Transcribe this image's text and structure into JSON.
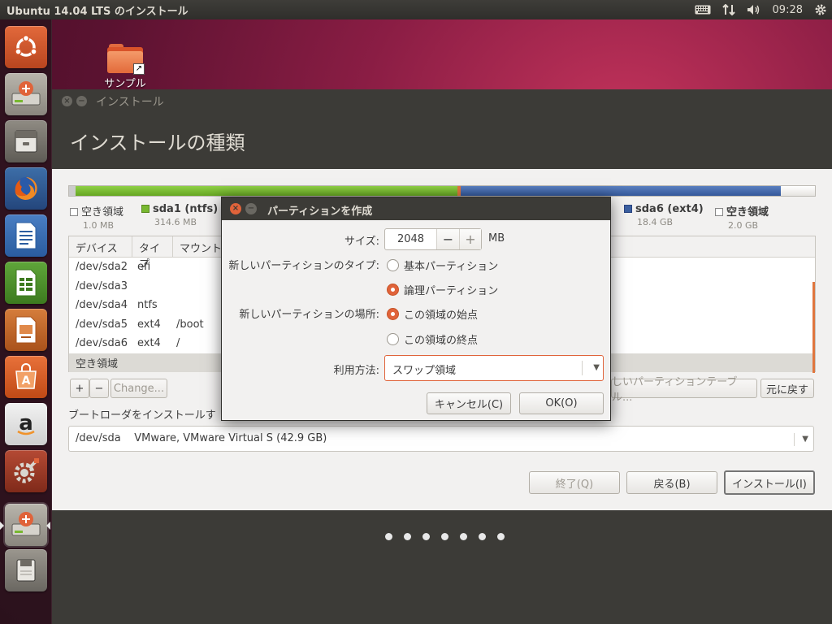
{
  "top_panel": {
    "title": "Ubuntu 14.04 LTS のインストール",
    "clock": "09:28",
    "icons": [
      "keyboard-icon",
      "network-icon",
      "volume-icon",
      "gear-icon"
    ]
  },
  "launcher": {
    "items": [
      "dash-home",
      "installer",
      "file-manager",
      "firefox",
      "libreoffice-writer",
      "libreoffice-calc",
      "libreoffice-impress",
      "software-center",
      "amazon",
      "system-settings",
      "installer-running",
      "trash"
    ]
  },
  "desktop": {
    "icon_label": "サンプル"
  },
  "installer": {
    "window_title": "インストール",
    "heading": "インストールの種類",
    "partition_bar": {
      "segments": [
        {
          "name": "空き領域",
          "color": "#ffffff",
          "size": "1.0 MB"
        },
        {
          "name": "sda1 (ntfs)",
          "color": "#78b830",
          "size": "314.6 MB"
        },
        {
          "name": "sda6 (ext4)",
          "color": "#3b5fa0",
          "size": "18.4 GB"
        },
        {
          "name": "空き領域",
          "color": "#ffffff",
          "size": "2.0 GB"
        }
      ]
    },
    "table": {
      "headers": [
        "デバイス",
        "タイプ",
        "マウント"
      ],
      "rows": [
        {
          "device": "/dev/sda2",
          "type": "efi",
          "mount": ""
        },
        {
          "device": "/dev/sda3",
          "type": "",
          "mount": ""
        },
        {
          "device": "/dev/sda4",
          "type": "ntfs",
          "mount": ""
        },
        {
          "device": "/dev/sda5",
          "type": "ext4",
          "mount": "/boot"
        },
        {
          "device": "/dev/sda6",
          "type": "ext4",
          "mount": "/"
        },
        {
          "device": "空き領域",
          "type": "",
          "mount": ""
        }
      ]
    },
    "toolbar": {
      "add": "+",
      "remove": "−",
      "change": "Change...",
      "new_table": "しいパーティションテーブル...",
      "revert": "元に戻す"
    },
    "bootloader_label": "ブートローダをインストールす",
    "bootloader_device": "/dev/sda    VMware, VMware Virtual S (42.9 GB)",
    "buttons": {
      "quit": "終了(Q)",
      "back": "戻る(B)",
      "install": "インストール(I)"
    }
  },
  "dialog": {
    "title": "パーティションを作成",
    "size_label": "サイズ:",
    "size_value": "2048",
    "size_unit": "MB",
    "minus": "−",
    "plus": "+",
    "type_label": "新しいパーティションのタイプ:",
    "type_options": [
      "基本パーティション",
      "論理パーティション"
    ],
    "type_selected": 1,
    "location_label": "新しいパーティションの場所:",
    "location_options": [
      "この領域の始点",
      "この領域の終点"
    ],
    "location_selected": 0,
    "use_label": "利用方法:",
    "use_value": "スワップ領域",
    "cancel": "キャンセル(C)",
    "ok": "OK(O)"
  }
}
